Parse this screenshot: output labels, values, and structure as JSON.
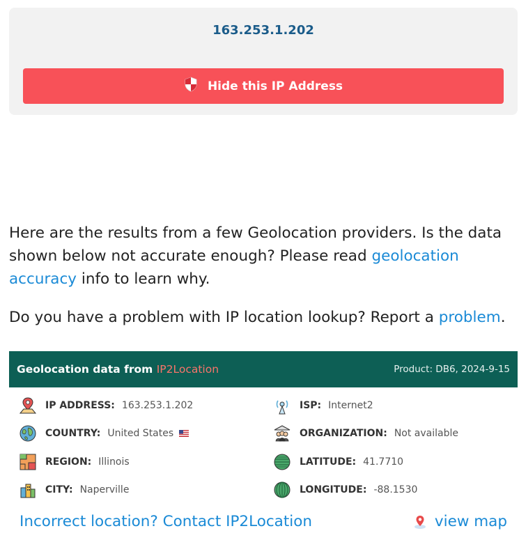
{
  "ip_card": {
    "ip": "163.253.1.202",
    "hide_button_label": "Hide this IP Address",
    "hide_icon": "shield-icon"
  },
  "info": {
    "p1_text_a": "Here are the results from a few Geolocation providers. Is the data shown below not accurate enough? Please read ",
    "p1_link": "geolocation accuracy",
    "p1_text_b": " info to learn why.",
    "p2_text_a": "Do you have a problem with IP location lookup? Report a ",
    "p2_link": "problem",
    "p2_text_b": "."
  },
  "geo": {
    "title_prefix": "Geolocation data from ",
    "provider": "IP2Location",
    "product": "Product: DB6, 2024-9-15",
    "colors": {
      "header_bg": "#0d5f55",
      "brand": "#f8746a",
      "link": "#1a8ad6",
      "hide_btn": "#f85158"
    },
    "fields": {
      "ip_label": "IP ADDRESS:",
      "ip_value": "163.253.1.202",
      "country_label": "COUNTRY:",
      "country_value": "United States",
      "region_label": "REGION:",
      "region_value": "Illinois",
      "city_label": "CITY:",
      "city_value": "Naperville",
      "isp_label": "ISP:",
      "isp_value": "Internet2",
      "org_label": "ORGANIZATION:",
      "org_value": "Not available",
      "lat_label": "LATITUDE:",
      "lat_value": "41.7710",
      "lon_label": "LONGITUDE:",
      "lon_value": "-88.1530"
    },
    "incorrect_link": "Incorrect location? Contact IP2Location",
    "map_link": "view map"
  }
}
